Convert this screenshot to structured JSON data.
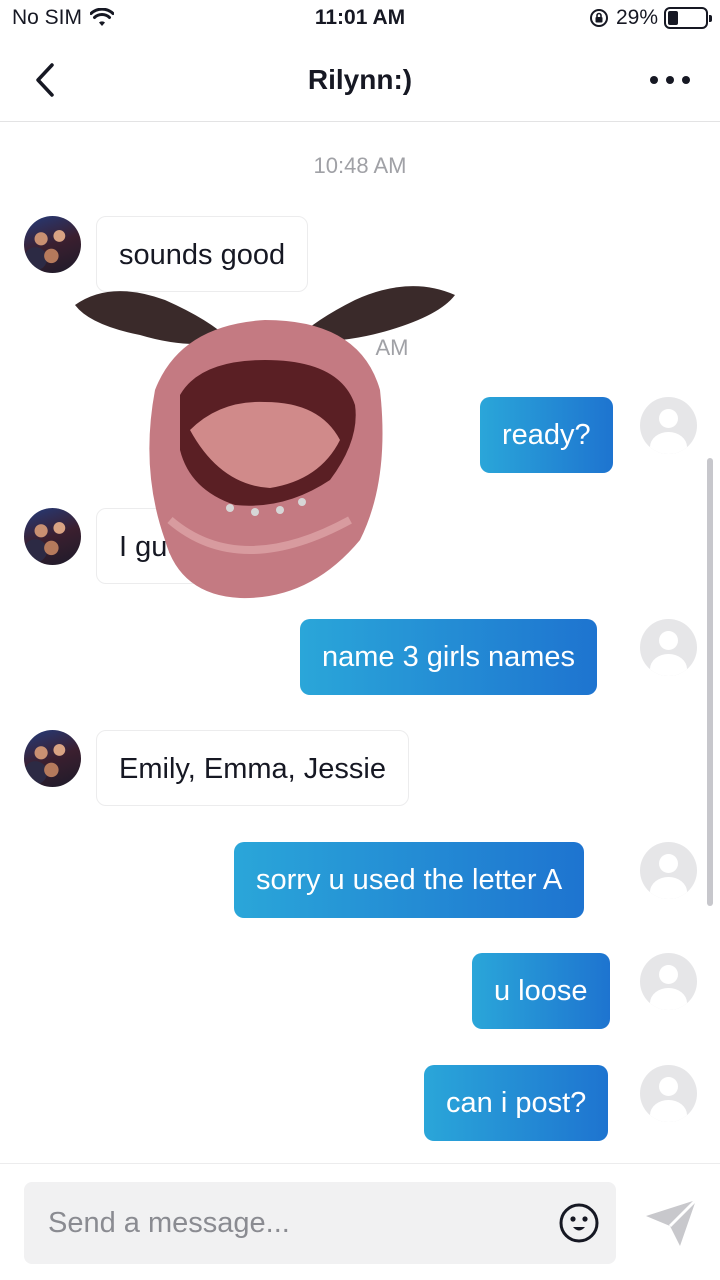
{
  "status_bar": {
    "carrier": "No SIM",
    "time": "11:01 AM",
    "battery": "29%",
    "battery_level": 0.29
  },
  "header": {
    "title": "Rilynn:)"
  },
  "thread": {
    "timestamp_1": "10:48 AM",
    "timestamp_2_fragment": "AM",
    "messages": [
      {
        "side": "in",
        "text": "sounds good"
      },
      {
        "side": "out",
        "text": "ready?"
      },
      {
        "side": "in",
        "text": "I gue"
      },
      {
        "side": "out",
        "text": "name 3 girls names"
      },
      {
        "side": "in",
        "text": "Emily, Emma, Jessie"
      },
      {
        "side": "out",
        "text": "sorry u used the letter A"
      },
      {
        "side": "out",
        "text": "u loose"
      },
      {
        "side": "out",
        "text": "can i post?"
      }
    ]
  },
  "composer": {
    "placeholder": "Send a message..."
  },
  "icons": {
    "back": "chevron-left-icon",
    "more": "more-horizontal-icon",
    "emoji": "emoji-icon",
    "send": "send-icon",
    "wifi": "wifi-icon",
    "rotation_lock": "rotation-lock-icon",
    "battery": "battery-icon"
  },
  "colors": {
    "outgoing_bubble_start": "#2aa6d9",
    "outgoing_bubble_end": "#1e74d0",
    "timestamp": "#a0a1a6"
  }
}
